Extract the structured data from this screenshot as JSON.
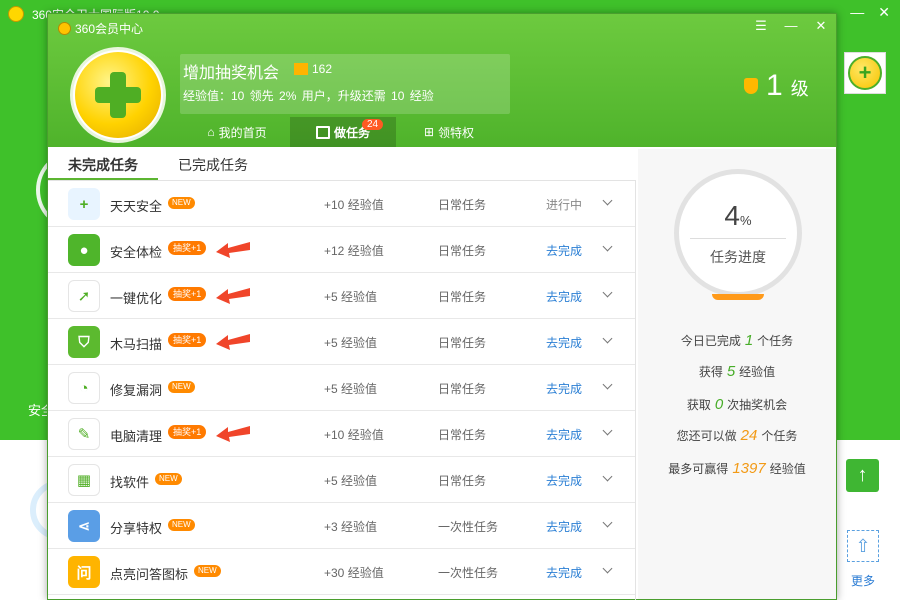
{
  "background_app": {
    "title": "360安全卫士国际版10.0",
    "safe_text": "安全",
    "more_label": "更多"
  },
  "window": {
    "title": "360会员中心",
    "user": {
      "name": "增加抽奖机会",
      "level_points": "162",
      "exp_label": "经验值：10   领先 2% 用户，升级还需 10 经验"
    },
    "level": {
      "value": "1",
      "unit": "级"
    },
    "tabs": [
      {
        "label": "我的首页",
        "icon": "home-icon"
      },
      {
        "label": "做任务",
        "icon": "task-checkbox-icon",
        "count": "24"
      },
      {
        "label": "领特权",
        "icon": "grid-icon"
      }
    ],
    "subtabs": [
      "未完成任务",
      "已完成任务"
    ],
    "tasks": [
      {
        "name": "天天安全",
        "badge": "NEW",
        "exp": "+10 经验值",
        "type": "日常任务",
        "status": "进行中",
        "icon": "browser-plus-icon",
        "color": "#e8f4ff"
      },
      {
        "name": "安全体检",
        "badge": "抽奖+1",
        "exp": "+12 经验值",
        "type": "日常任务",
        "status": "去完成",
        "icon": "checkup-icon",
        "color": "#4fb52b"
      },
      {
        "name": "一键优化",
        "badge": "抽奖+1",
        "exp": "+5 经验值",
        "type": "日常任务",
        "status": "去完成",
        "icon": "rocket-icon",
        "color": "#ffffff"
      },
      {
        "name": "木马扫描",
        "badge": "抽奖+1",
        "exp": "+5 经验值",
        "type": "日常任务",
        "status": "去完成",
        "icon": "shield-scan-icon",
        "color": "#5cba2f"
      },
      {
        "name": "修复漏洞",
        "badge": "NEW",
        "exp": "+5 经验值",
        "type": "日常任务",
        "status": "去完成",
        "icon": "repair-icon",
        "color": "#ffffff"
      },
      {
        "name": "电脑清理",
        "badge": "抽奖+1",
        "exp": "+10 经验值",
        "type": "日常任务",
        "status": "去完成",
        "icon": "broom-icon",
        "color": "#ffffff"
      },
      {
        "name": "找软件",
        "badge": "NEW",
        "exp": "+5 经验值",
        "type": "日常任务",
        "status": "去完成",
        "icon": "software-grid-icon",
        "color": "#ffffff"
      },
      {
        "name": "分享特权",
        "badge": "NEW",
        "exp": "+3 经验值",
        "type": "一次性任务",
        "status": "去完成",
        "icon": "share-icon",
        "color": "#5a9ee6"
      },
      {
        "name": "点亮问答图标",
        "badge": "NEW",
        "exp": "+30 经验值",
        "type": "一次性任务",
        "status": "去完成",
        "icon": "qa-icon",
        "color": "#ffb400"
      }
    ],
    "progress": {
      "value": "4",
      "unit": "%",
      "label": "任务进度"
    },
    "stats": [
      {
        "pre": "今日已完成",
        "num": "1",
        "post": "个任务",
        "style": "g"
      },
      {
        "pre": "获得",
        "num": "5",
        "post": "经验值",
        "style": "g"
      },
      {
        "pre": "获取",
        "num": "0",
        "post": "次抽奖机会",
        "style": "g"
      },
      {
        "pre": "您还可以做",
        "num": "24",
        "post": "个任务",
        "style": "o"
      },
      {
        "pre": "最多可赢得",
        "num": "1397",
        "post": "经验值",
        "style": "o"
      }
    ]
  }
}
